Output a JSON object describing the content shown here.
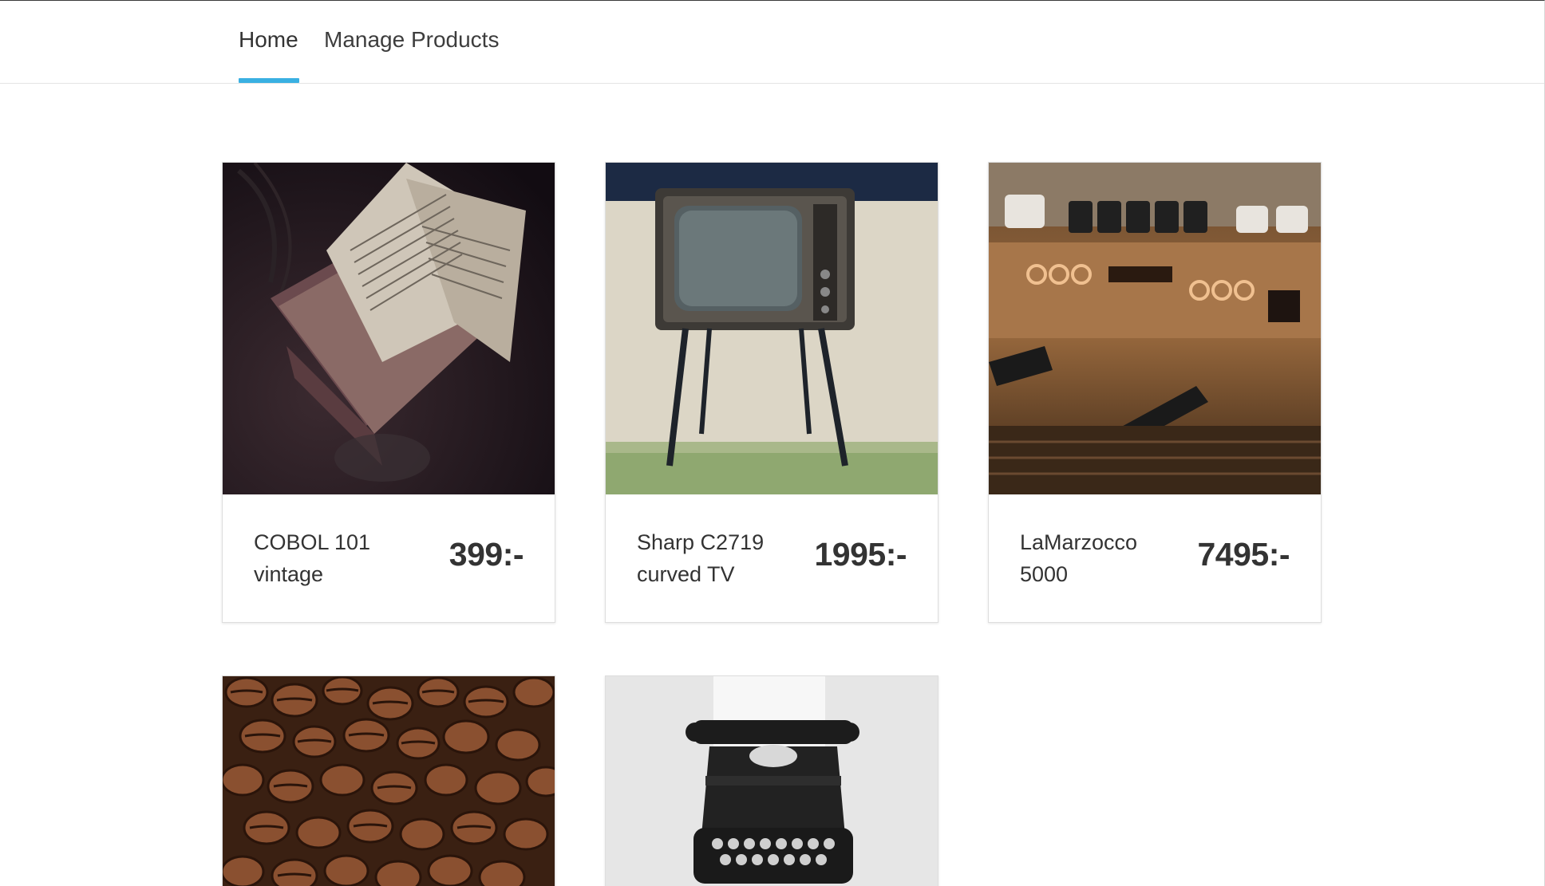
{
  "nav": {
    "tabs": [
      {
        "label": "Home",
        "active": true
      },
      {
        "label": "Manage Products",
        "active": false
      }
    ],
    "accent_color": "#3ab0e2"
  },
  "products": [
    {
      "name": "COBOL 101 vintage",
      "price": "399:-",
      "image": "old-book-photo"
    },
    {
      "name": "Sharp C2719 curved TV",
      "price": "1995:-",
      "image": "vintage-tv-photo"
    },
    {
      "name": "LaMarzocco 5000",
      "price": "7495:-",
      "image": "espresso-machine-photo"
    },
    {
      "name": "",
      "price": "",
      "image": "coffee-beans-photo"
    },
    {
      "name": "",
      "price": "",
      "image": "typewriter-photo"
    }
  ]
}
